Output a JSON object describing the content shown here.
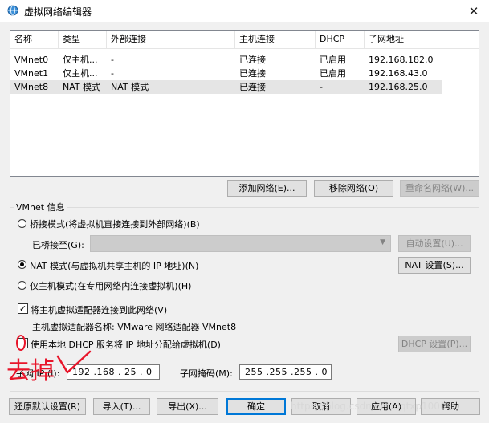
{
  "window": {
    "title": "虚拟网络编辑器",
    "close_glyph": "✕"
  },
  "list": {
    "columns": [
      "名称",
      "类型",
      "外部连接",
      "主机连接",
      "DHCP",
      "子网地址"
    ],
    "rows": [
      {
        "name": "VMnet0",
        "type": "仅主机...",
        "external": "-",
        "host": "已连接",
        "dhcp": "已启用",
        "subnet": "192.168.182.0"
      },
      {
        "name": "VMnet1",
        "type": "仅主机...",
        "external": "-",
        "host": "已连接",
        "dhcp": "已启用",
        "subnet": "192.168.43.0"
      },
      {
        "name": "VMnet8",
        "type": "NAT 模式",
        "external": "NAT 模式",
        "host": "已连接",
        "dhcp": "-",
        "subnet": "192.168.25.0"
      }
    ]
  },
  "list_buttons": {
    "add": "添加网络(E)...",
    "remove": "移除网络(O)",
    "rename": "重命名网络(W)..."
  },
  "vmnet_info": {
    "title": "VMnet 信息",
    "bridged_label": "桥接模式(将虚拟机直接连接到外部网络)(B)",
    "bridged_to_label": "已桥接至(G):",
    "auto_button": "自动设置(U)...",
    "nat_label": "NAT 模式(与虚拟机共享主机的 IP 地址)(N)",
    "nat_button": "NAT 设置(S)...",
    "hostonly_label": "仅主机模式(在专用网络内连接虚拟机)(H)",
    "connect_adapter_label": "将主机虚拟适配器连接到此网络(V)",
    "adapter_name_label": "主机虚拟适配器名称: VMware 网络适配器 VMnet8",
    "dhcp_label": "使用本地 DHCP 服务将 IP 地址分配给虚拟机(D)",
    "dhcp_button": "DHCP 设置(P)...",
    "subnet_ip_label": "子网 IP (I):",
    "subnet_ip_value": "192 .168 . 25 . 0",
    "subnet_mask_label": "子网掩码(M):",
    "subnet_mask_value": "255 .255 .255 . 0",
    "mode_selected": "nat",
    "connect_adapter_checked": true,
    "dhcp_checked": false
  },
  "footer": {
    "restore": "还原默认设置(R)",
    "import": "导入(T)...",
    "export": "导出(X)...",
    "ok": "确定",
    "cancel": "取消",
    "apply": "应用(A)",
    "help": "帮助"
  },
  "annotation": {
    "text": "去掉",
    "color": "#e8152a"
  },
  "watermark": "https://blog.csdn.net/dqtxp1000"
}
